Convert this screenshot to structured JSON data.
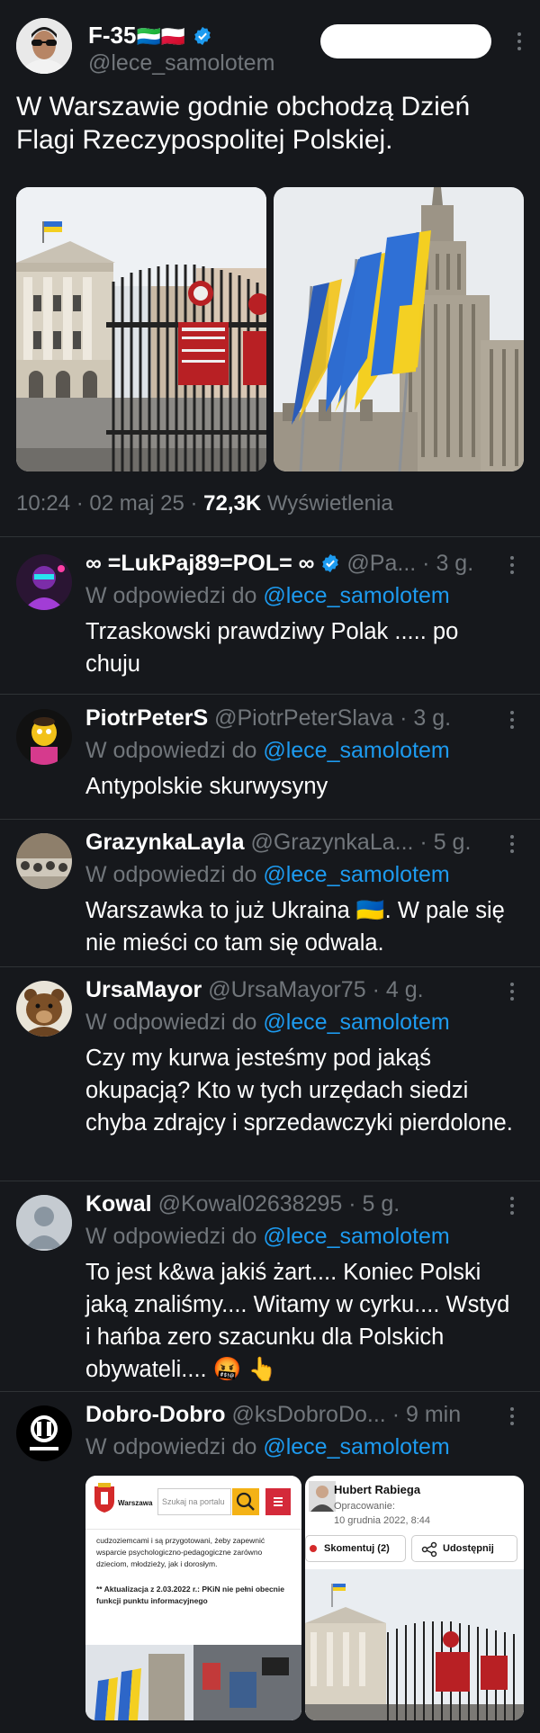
{
  "main_tweet": {
    "name": "F-35",
    "flags": "🇸🇱🇵🇱",
    "handle": "@lece_samolotem",
    "text": "W Warszawie godnie obchodzą Dzień Flagi Rzeczypospolitej Polskiej.",
    "time": "10:24 · 02 maj 25 · ",
    "views": "72,3K",
    "views_label": " Wyświetlenia"
  },
  "replies": [
    {
      "name": "∞ =LukPaj89=POL= ∞",
      "verified": true,
      "handle": "@Pa...",
      "age": "· 3 g.",
      "reply_prefix": "W odpowiedzi do ",
      "reply_to": "@lece_samolotem",
      "text": "Trzaskowski prawdziwy Polak ..... po chuju"
    },
    {
      "name": "PiotrPeterS",
      "handle": "@PiotrPeterSlava",
      "age": "· 3 g.",
      "reply_prefix": "W odpowiedzi do ",
      "reply_to": "@lece_samolotem",
      "text": "Antypolskie skurwysyny"
    },
    {
      "name": "GrazynkaLayla",
      "handle": "@GrazynkaLa...",
      "age": "· 5 g.",
      "reply_prefix": "W odpowiedzi do ",
      "reply_to": "@lece_samolotem",
      "text": "Warszawka to już Ukraina 🇺🇦. W pale się nie mieści co tam się odwala."
    },
    {
      "name": "UrsaMayor",
      "handle": "@UrsaMayor75",
      "age": "· 4 g.",
      "reply_prefix": "W odpowiedzi do ",
      "reply_to": "@lece_samolotem",
      "text": "Czy my kurwa jesteśmy pod jakąś okupacją? Kto w tych urzędach siedzi chyba zdrajcy i sprzedawczyki pierdolone."
    },
    {
      "name": "Kowal",
      "handle": "@Kowal02638295",
      "age": "· 5 g.",
      "reply_prefix": "W odpowiedzi do ",
      "reply_to": "@lece_samolotem",
      "text": "To jest k&wa jakiś żart.... Koniec Polski jaką znaliśmy.... Witamy w cyrku.... Wstyd i hańba zero szacunku dla Polskich obywateli.... 🤬 👆"
    },
    {
      "name": "Dobro-Dobro",
      "handle": "@ksDobroDo...",
      "age": "· 9 min",
      "reply_prefix": "W odpowiedzi do ",
      "reply_to": "@lece_samolotem"
    }
  ],
  "quoted_left": {
    "site": "Warszawa",
    "search_placeholder": "Szukaj na portalu",
    "para1": "cudzoziemcami i są przygotowani, żeby zapewnić wsparcie psychologiczno-pedagogiczne zarówno dzieciom, młodzieży, jak i dorosłym.",
    "para2": "** Aktualizacja z 2.03.2022 r.: PKiN nie pełni obecnie funkcji punktu informacyjnego"
  },
  "quoted_right": {
    "author": "Hubert Rabiega",
    "byline": "Opracowanie:",
    "date": "10 grudnia 2022, 8:44",
    "comment_button": "Skomentuj (2)",
    "share_button": "Udostępnij"
  }
}
